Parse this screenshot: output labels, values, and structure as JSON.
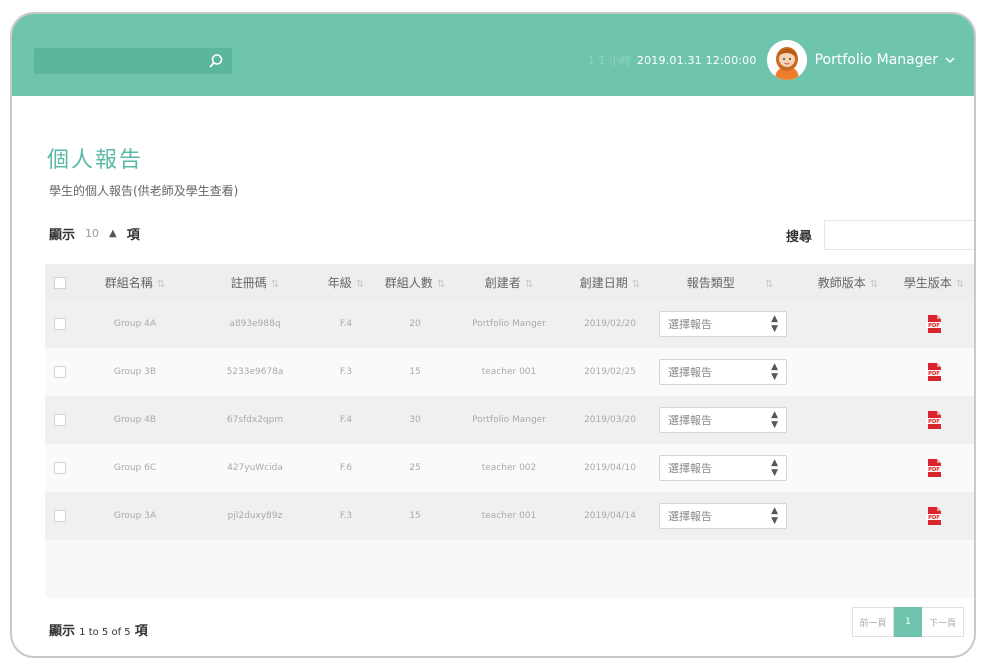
{
  "header": {
    "status_text": "1 1 小時",
    "datetime": "2019.01.31 12:00:00",
    "user_name": "Portfolio Manager"
  },
  "page": {
    "title": "個人報告",
    "subtitle": "學生的個人報告(供老師及學生查看)"
  },
  "controls": {
    "show_label": "顯示",
    "length_value": "10",
    "items_label": "項",
    "search_label": "搜尋"
  },
  "table": {
    "columns": [
      "群組名稱",
      "註冊碼",
      "年級",
      "群組人數",
      "創建者",
      "創建日期",
      "報告類型",
      "教師版本",
      "學生版本"
    ],
    "select_placeholder": "選擇報告",
    "rows": [
      {
        "group": "Group 4A",
        "code": "a893e988q",
        "grade": "F.4",
        "count": "20",
        "creator": "Portfolio Manger",
        "date": "2019/02/20"
      },
      {
        "group": "Group 3B",
        "code": "5233e9678a",
        "grade": "F.3",
        "count": "15",
        "creator": "teacher 001",
        "date": "2019/02/25"
      },
      {
        "group": "Group 4B",
        "code": "67sfdx2qpm",
        "grade": "F.4",
        "count": "30",
        "creator": "Portfolio Manger",
        "date": "2019/03/20"
      },
      {
        "group": "Group 6C",
        "code": "427yuWcida",
        "grade": "F.6",
        "count": "25",
        "creator": "teacher 002",
        "date": "2019/04/10"
      },
      {
        "group": "Group 3A",
        "code": "pjl2duxy89z",
        "grade": "F.3",
        "count": "15",
        "creator": "teacher 001",
        "date": "2019/04/14"
      }
    ]
  },
  "footer": {
    "show_label": "顯示",
    "range_text": "1 to 5 of 5",
    "items_label": "項"
  },
  "pagination": {
    "prev": "前一頁",
    "current": "1",
    "next": "下一頁"
  },
  "colors": {
    "header_bg": "#6fc4ad",
    "title": "#5ab9a6",
    "pdf_red": "#d9262e"
  },
  "icons": {
    "search": "search-icon",
    "dropdown": "chevron-down-icon",
    "pdf": "pdf-icon"
  }
}
